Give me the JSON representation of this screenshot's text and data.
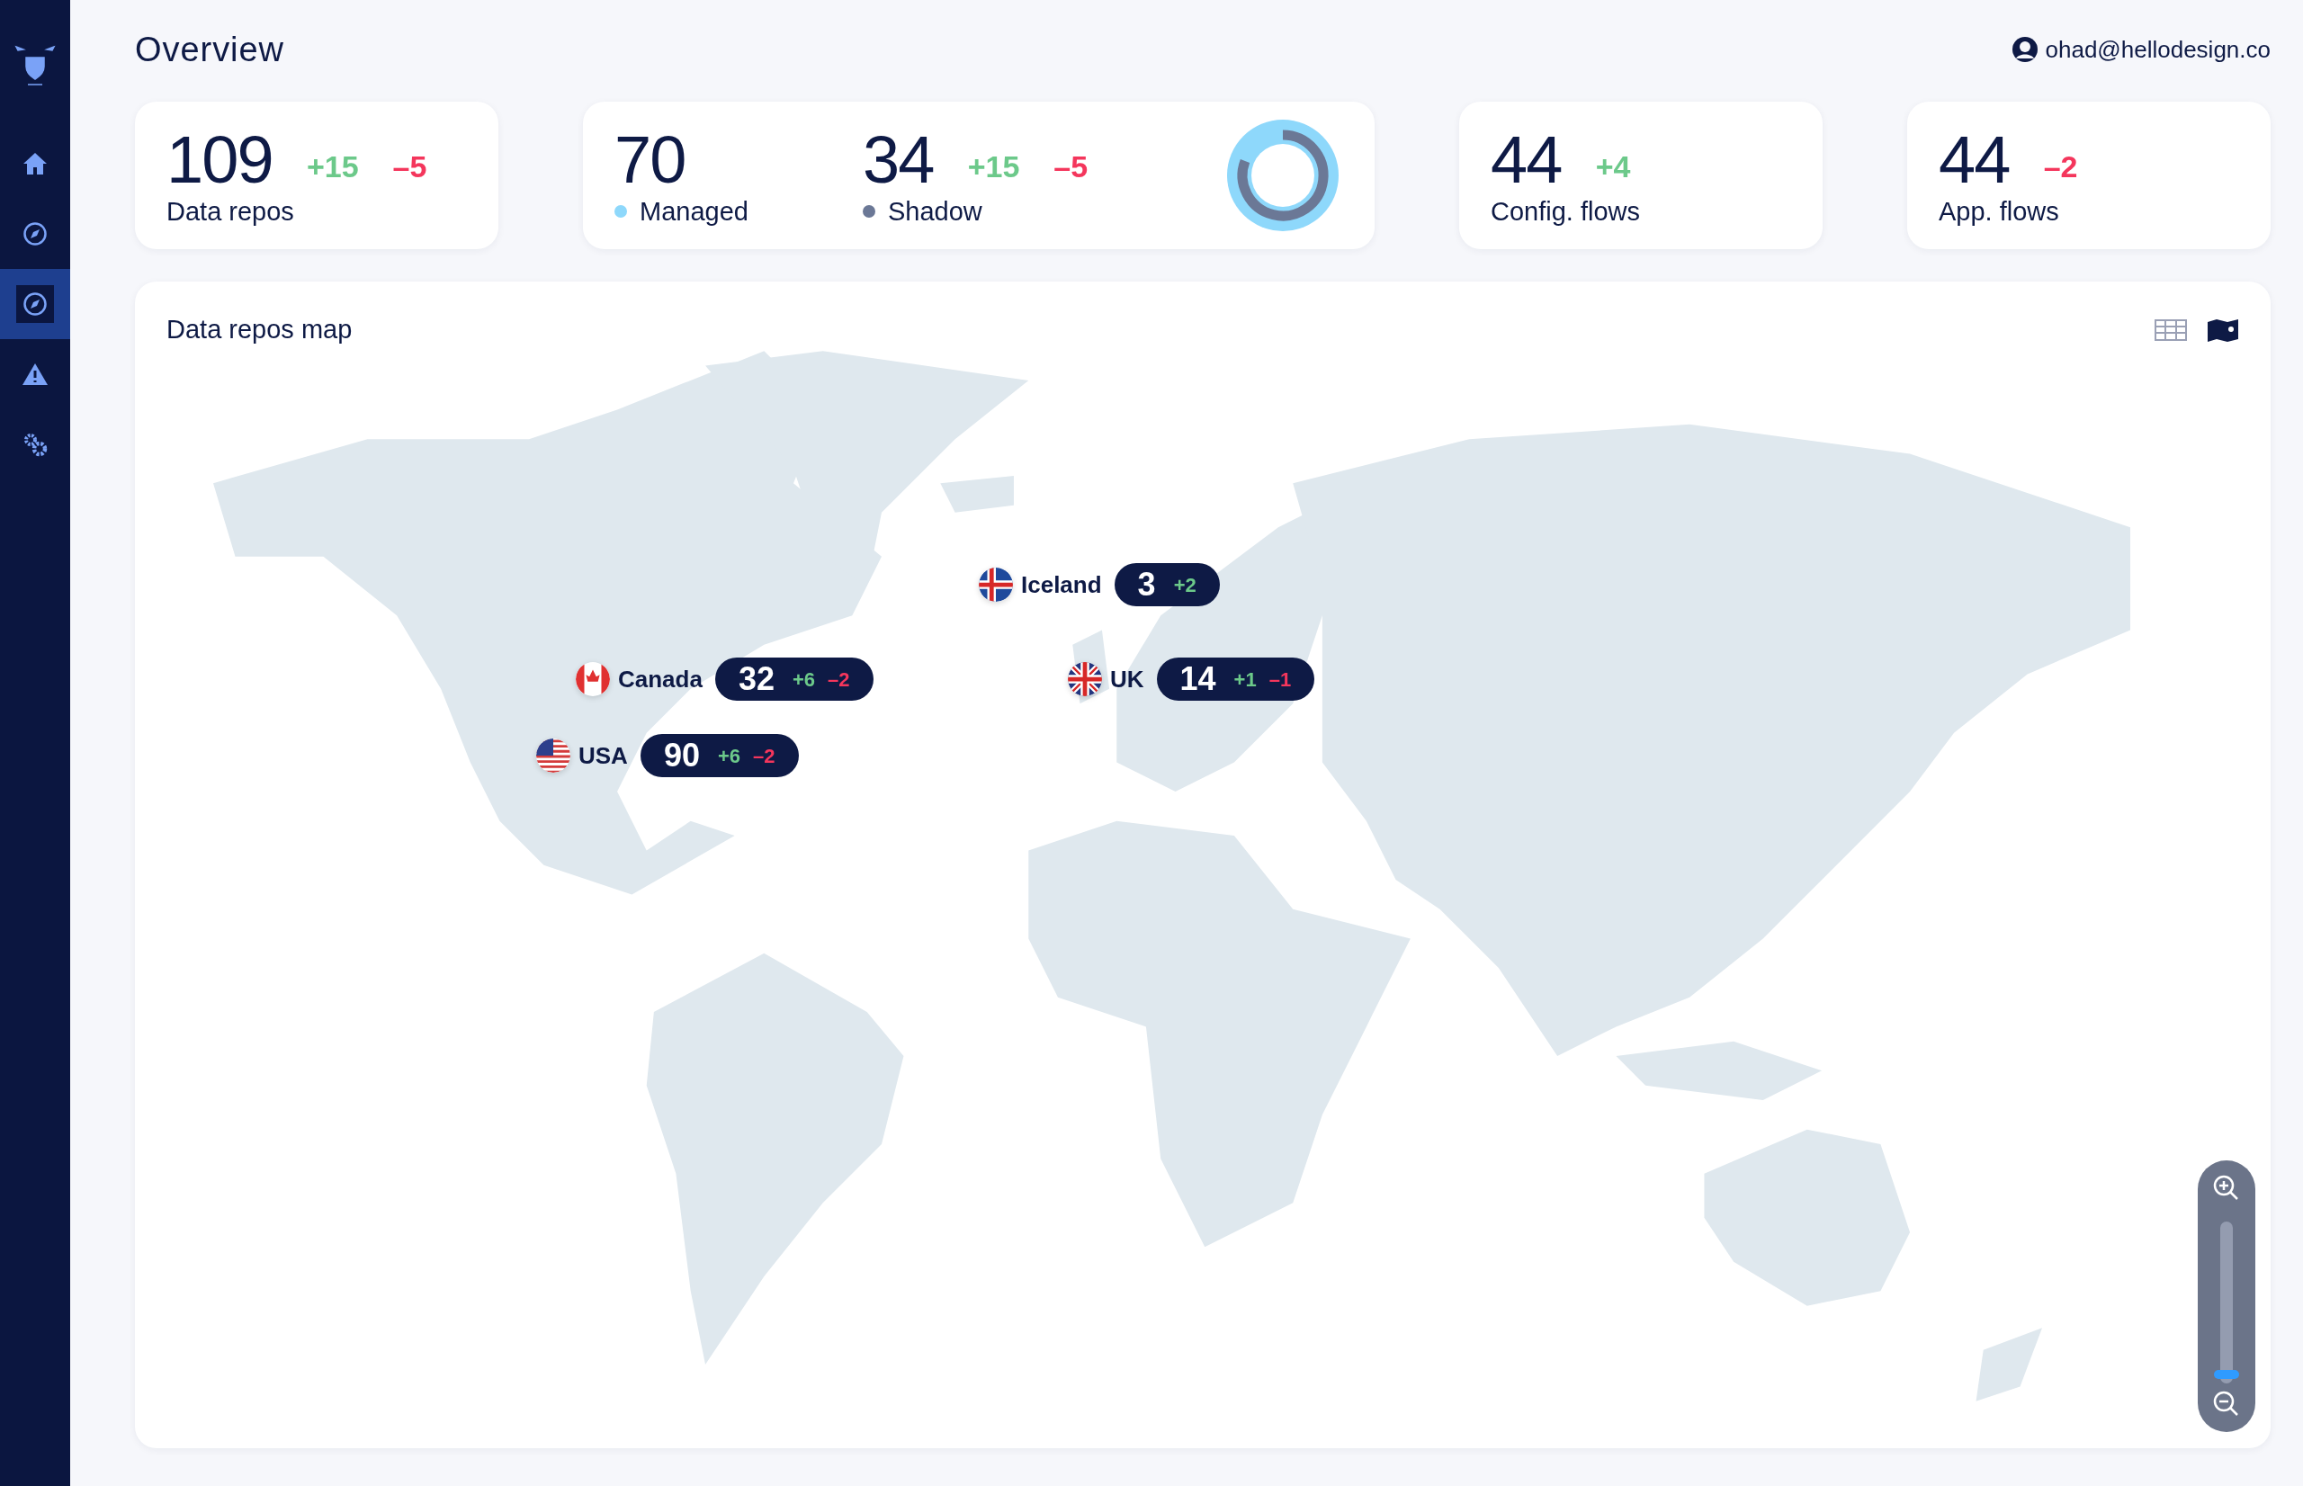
{
  "sidebar": {
    "items": [
      {
        "selected": false
      },
      {
        "selected": false
      },
      {
        "selected": true
      },
      {
        "selected": false
      },
      {
        "selected": false
      }
    ]
  },
  "header": {
    "title": "Overview",
    "user_email": "ohad@hellodesign.co"
  },
  "stat_cards": [
    {
      "kind": "single",
      "value": "109",
      "label": "Data repos",
      "increase": "+15",
      "decrease": "–5"
    },
    {
      "kind": "split",
      "groups": [
        {
          "value": "70",
          "label": "Managed",
          "color": "#8ed8fb"
        },
        {
          "value": "34",
          "label": "Shadow",
          "color": "#6b7896",
          "increase": "+15",
          "decrease": "–5"
        }
      ]
    },
    {
      "kind": "single",
      "value": "44",
      "label": "Config. flows",
      "increase": "+4"
    },
    {
      "kind": "single",
      "value": "44",
      "label": "App. flows",
      "decrease": "–2"
    }
  ],
  "map_panel": {
    "title": "Data repos map",
    "view_toggle": [
      {
        "selected": false
      },
      {
        "selected": true
      }
    ],
    "markers": [
      {
        "country": "Iceland",
        "count": "3",
        "increase": "+2"
      },
      {
        "country": "Canada",
        "count": "32",
        "increase": "+6",
        "decrease": "–2"
      },
      {
        "country": "USA",
        "count": "90",
        "increase": "+6",
        "decrease": "–2"
      },
      {
        "country": "UK",
        "count": "14",
        "increase": "+1",
        "decrease": "–1"
      }
    ],
    "zoom": {
      "level": 0.03
    }
  }
}
